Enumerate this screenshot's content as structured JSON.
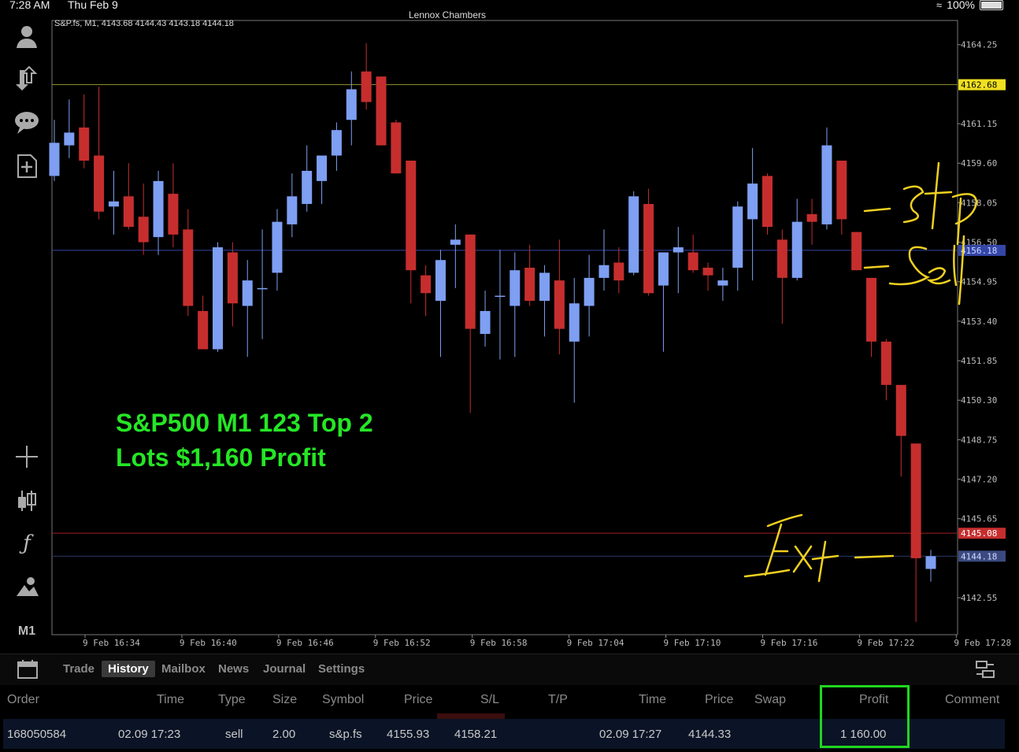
{
  "status": {
    "time": "7:28 AM",
    "date": "Thu Feb 9",
    "battery": "100%"
  },
  "window_title": "Lennox Chambers",
  "toolbar_icons": [
    "account-icon",
    "deposit-icon",
    "chat-icon",
    "new-document-icon",
    "crosshair-icon",
    "candlestick-icon",
    "indicator-icon",
    "objects-icon"
  ],
  "toolbar_timeframe": "M1",
  "chart": {
    "info": "S&P.fs, M1, 4143.68 4144.43 4143.18 4144.18",
    "overlay_line1": "S&P500 M1 123 Top 2",
    "overlay_line2": "Lots $1,160 Profit",
    "annotations": [
      "Stop",
      "Sell",
      "Exit"
    ],
    "colors": {
      "bull": "#7e9ff2",
      "bear": "#c62e2e",
      "overlay_text": "#25e625",
      "handwriting": "#f0d020"
    }
  },
  "chart_data": {
    "type": "candlestick",
    "symbol": "S&P.fs",
    "timeframe": "M1",
    "y_ticks": [
      "4164.25",
      "4161.15",
      "4159.60",
      "4158.05",
      "4156.50",
      "4154.95",
      "4153.40",
      "4151.85",
      "4150.30",
      "4148.75",
      "4147.20",
      "4145.65",
      "4142.55"
    ],
    "x_ticks": [
      "9 Feb 16:34",
      "9 Feb 16:40",
      "9 Feb 16:46",
      "9 Feb 16:52",
      "9 Feb 16:58",
      "9 Feb 17:04",
      "9 Feb 17:10",
      "9 Feb 17:16",
      "9 Feb 17:22",
      "9 Feb 17:28"
    ],
    "ylim": [
      4141.1,
      4165.2
    ],
    "price_lines": [
      {
        "label": "4162.68",
        "value": 4162.68,
        "color": "#8a8a2a",
        "label_bg": "#f0e020",
        "label_fg": "#000"
      },
      {
        "label": "4156.18",
        "value": 4156.18,
        "color": "#3446a8",
        "label_bg": "#3446a8",
        "label_fg": "#cfd8ff"
      },
      {
        "label": "4145.08",
        "value": 4145.08,
        "color": "#a02020",
        "label_bg": "#c62e2e",
        "label_fg": "#fff"
      },
      {
        "label": "4144.18",
        "value": 4144.18,
        "color": "#2a3a66",
        "label_bg": "#3a4a80",
        "label_fg": "#cfd8ff"
      }
    ],
    "candles": [
      {
        "o": 4159.1,
        "h": 4161.3,
        "l": 4158.9,
        "c": 4160.4
      },
      {
        "o": 4160.3,
        "h": 4162.1,
        "l": 4159.8,
        "c": 4160.8
      },
      {
        "o": 4161.0,
        "h": 4162.3,
        "l": 4159.4,
        "c": 4159.7
      },
      {
        "o": 4159.9,
        "h": 4162.6,
        "l": 4157.4,
        "c": 4157.7
      },
      {
        "o": 4157.9,
        "h": 4159.3,
        "l": 4156.8,
        "c": 4158.1
      },
      {
        "o": 4158.3,
        "h": 4159.6,
        "l": 4157.0,
        "c": 4157.1
      },
      {
        "o": 4157.5,
        "h": 4158.8,
        "l": 4156.0,
        "c": 4156.5
      },
      {
        "o": 4156.7,
        "h": 4159.3,
        "l": 4156.0,
        "c": 4158.9
      },
      {
        "o": 4158.4,
        "h": 4159.6,
        "l": 4156.3,
        "c": 4156.8
      },
      {
        "o": 4157.0,
        "h": 4157.8,
        "l": 4153.6,
        "c": 4154.0
      },
      {
        "o": 4153.8,
        "h": 4154.4,
        "l": 4152.3,
        "c": 4152.3
      },
      {
        "o": 4152.3,
        "h": 4156.5,
        "l": 4152.2,
        "c": 4156.3
      },
      {
        "o": 4156.1,
        "h": 4156.5,
        "l": 4153.2,
        "c": 4154.1
      },
      {
        "o": 4154.0,
        "h": 4155.8,
        "l": 4152.0,
        "c": 4155.0
      },
      {
        "o": 4154.7,
        "h": 4157.0,
        "l": 4152.7,
        "c": 4154.7
      },
      {
        "o": 4155.3,
        "h": 4157.8,
        "l": 4154.6,
        "c": 4157.3
      },
      {
        "o": 4157.2,
        "h": 4159.2,
        "l": 4156.7,
        "c": 4158.3
      },
      {
        "o": 4158.0,
        "h": 4160.3,
        "l": 4157.7,
        "c": 4159.3
      },
      {
        "o": 4158.9,
        "h": 4159.8,
        "l": 4158.0,
        "c": 4159.9
      },
      {
        "o": 4159.9,
        "h": 4161.2,
        "l": 4159.3,
        "c": 4160.9
      },
      {
        "o": 4161.3,
        "h": 4163.2,
        "l": 4160.3,
        "c": 4162.5
      },
      {
        "o": 4163.2,
        "h": 4164.3,
        "l": 4161.7,
        "c": 4162.0
      },
      {
        "o": 4163.0,
        "h": 4163.0,
        "l": 4160.3,
        "c": 4160.3
      },
      {
        "o": 4161.2,
        "h": 4161.3,
        "l": 4159.2,
        "c": 4159.2
      },
      {
        "o": 4159.7,
        "h": 4159.7,
        "l": 4154.1,
        "c": 4155.4
      },
      {
        "o": 4155.2,
        "h": 4155.6,
        "l": 4153.6,
        "c": 4154.5
      },
      {
        "o": 4154.2,
        "h": 4156.2,
        "l": 4152.0,
        "c": 4155.8
      },
      {
        "o": 4156.4,
        "h": 4157.2,
        "l": 4154.7,
        "c": 4156.6
      },
      {
        "o": 4156.8,
        "h": 4156.8,
        "l": 4149.8,
        "c": 4153.1
      },
      {
        "o": 4152.9,
        "h": 4154.6,
        "l": 4152.4,
        "c": 4153.8
      },
      {
        "o": 4154.4,
        "h": 4156.2,
        "l": 4151.9,
        "c": 4154.4
      },
      {
        "o": 4154.0,
        "h": 4156.1,
        "l": 4152.0,
        "c": 4155.4
      },
      {
        "o": 4155.5,
        "h": 4156.4,
        "l": 4154.0,
        "c": 4154.2
      },
      {
        "o": 4154.2,
        "h": 4155.6,
        "l": 4152.8,
        "c": 4155.3
      },
      {
        "o": 4155.0,
        "h": 4156.6,
        "l": 4152.1,
        "c": 4153.1
      },
      {
        "o": 4152.6,
        "h": 4155.1,
        "l": 4150.2,
        "c": 4154.1
      },
      {
        "o": 4154.0,
        "h": 4156.0,
        "l": 4152.8,
        "c": 4155.1
      },
      {
        "o": 4155.1,
        "h": 4157.0,
        "l": 4154.6,
        "c": 4155.6
      },
      {
        "o": 4155.7,
        "h": 4156.3,
        "l": 4154.5,
        "c": 4155.0
      },
      {
        "o": 4155.3,
        "h": 4158.5,
        "l": 4155.2,
        "c": 4158.3
      },
      {
        "o": 4158.0,
        "h": 4158.6,
        "l": 4154.4,
        "c": 4154.5
      },
      {
        "o": 4154.8,
        "h": 4156.1,
        "l": 4152.2,
        "c": 4156.1
      },
      {
        "o": 4156.1,
        "h": 4157.1,
        "l": 4154.5,
        "c": 4156.3
      },
      {
        "o": 4156.1,
        "h": 4156.8,
        "l": 4155.3,
        "c": 4155.4
      },
      {
        "o": 4155.5,
        "h": 4155.7,
        "l": 4154.6,
        "c": 4155.2
      },
      {
        "o": 4154.8,
        "h": 4155.5,
        "l": 4154.2,
        "c": 4155.0
      },
      {
        "o": 4155.5,
        "h": 4158.1,
        "l": 4154.6,
        "c": 4157.9
      },
      {
        "o": 4157.4,
        "h": 4160.2,
        "l": 4155.0,
        "c": 4158.8
      },
      {
        "o": 4159.1,
        "h": 4159.2,
        "l": 4156.8,
        "c": 4157.1
      },
      {
        "o": 4156.6,
        "h": 4157.0,
        "l": 4153.3,
        "c": 4155.1
      },
      {
        "o": 4155.1,
        "h": 4158.2,
        "l": 4155.0,
        "c": 4157.3
      },
      {
        "o": 4157.6,
        "h": 4158.2,
        "l": 4156.4,
        "c": 4157.3
      },
      {
        "o": 4157.2,
        "h": 4161.0,
        "l": 4157.0,
        "c": 4160.3
      },
      {
        "o": 4159.7,
        "h": 4159.7,
        "l": 4156.8,
        "c": 4157.4
      },
      {
        "o": 4156.9,
        "h": 4156.9,
        "l": 4155.6,
        "c": 4155.4
      },
      {
        "o": 4155.1,
        "h": 4155.1,
        "l": 4152.0,
        "c": 4152.6
      },
      {
        "o": 4152.6,
        "h": 4152.7,
        "l": 4150.3,
        "c": 4150.9
      },
      {
        "o": 4150.9,
        "h": 4150.9,
        "l": 4147.3,
        "c": 4148.9
      },
      {
        "o": 4148.6,
        "h": 4148.6,
        "l": 4141.6,
        "c": 4144.1
      },
      {
        "o": 4143.68,
        "h": 4144.43,
        "l": 4143.18,
        "c": 4144.18
      }
    ]
  },
  "tabs": [
    {
      "label": "Trade",
      "active": false
    },
    {
      "label": "History",
      "active": true
    },
    {
      "label": "Mailbox",
      "active": false
    },
    {
      "label": "News",
      "active": false
    },
    {
      "label": "Journal",
      "active": false
    },
    {
      "label": "Settings",
      "active": false
    }
  ],
  "history_table": {
    "headers": [
      "Order",
      "Time",
      "Type",
      "Size",
      "Symbol",
      "Price",
      "S/L",
      "T/P",
      "Time",
      "Price",
      "Swap",
      "Profit",
      "Comment"
    ],
    "row": {
      "order": "168050584",
      "open_time": "02.09 17:23",
      "type": "sell",
      "size": "2.00",
      "symbol": "s&p.fs",
      "open_price": "4155.93",
      "sl": "4158.21",
      "tp": "",
      "close_time": "02.09 17:27",
      "close_price": "4144.33",
      "swap": "",
      "profit": "1 160.00",
      "comment": ""
    }
  }
}
